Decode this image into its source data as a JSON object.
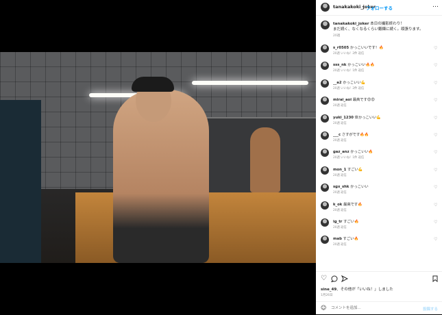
{
  "header": {
    "username": "tanakakoki_joker",
    "separator": "•",
    "follow_label": "フォローする",
    "more_label": "…"
  },
  "caption": {
    "username": "tanakakoki_joker",
    "line1": "本日の撮影終わり！",
    "line2": "まだ続く、なくなるくらい鍛錬に続く。頑張ります。",
    "meta": "20週"
  },
  "comments": [
    {
      "user": "s_r0505",
      "text": "かっこいいです！🔥",
      "meta": "20週 いいね！2件 返信"
    },
    {
      "user": "sss_nk",
      "text": "かっこいい🔥🔥",
      "meta": "20週 いいね！1件 返信"
    },
    {
      "user": "__a2",
      "text": "かっこいい💪",
      "meta": "20週 いいね！2件 返信"
    },
    {
      "user": "mirai_aoi",
      "text": "最高です😍😍",
      "meta": "20週 返信"
    },
    {
      "user": "yuki_1230",
      "text": "体かっこいい💪",
      "meta": "20週 返信"
    },
    {
      "user": "___c",
      "text": "さすがです🔥🔥",
      "meta": "20週 返信"
    },
    {
      "user": "gaz_anz",
      "text": "かっこいい🔥",
      "meta": "20週 いいね！1件 返信"
    },
    {
      "user": "mon_1",
      "text": "すごい💪",
      "meta": "20週 返信"
    },
    {
      "user": "sgx_shk",
      "text": "かっこいい",
      "meta": "20週 返信"
    },
    {
      "user": "k_ok",
      "text": "最高です🔥",
      "meta": "20週 返信"
    },
    {
      "user": "ig_tr",
      "text": "すごい🔥",
      "meta": "20週 返信"
    },
    {
      "user": "mab",
      "text": "すごい🔥",
      "meta": "20週 返信"
    }
  ],
  "likes": {
    "user": "sine_49",
    "text": "、その他が「いいね！」しました"
  },
  "date": "1月26日",
  "comment_bar": {
    "placeholder": "コメントを追加...",
    "post_label": "投稿する"
  }
}
